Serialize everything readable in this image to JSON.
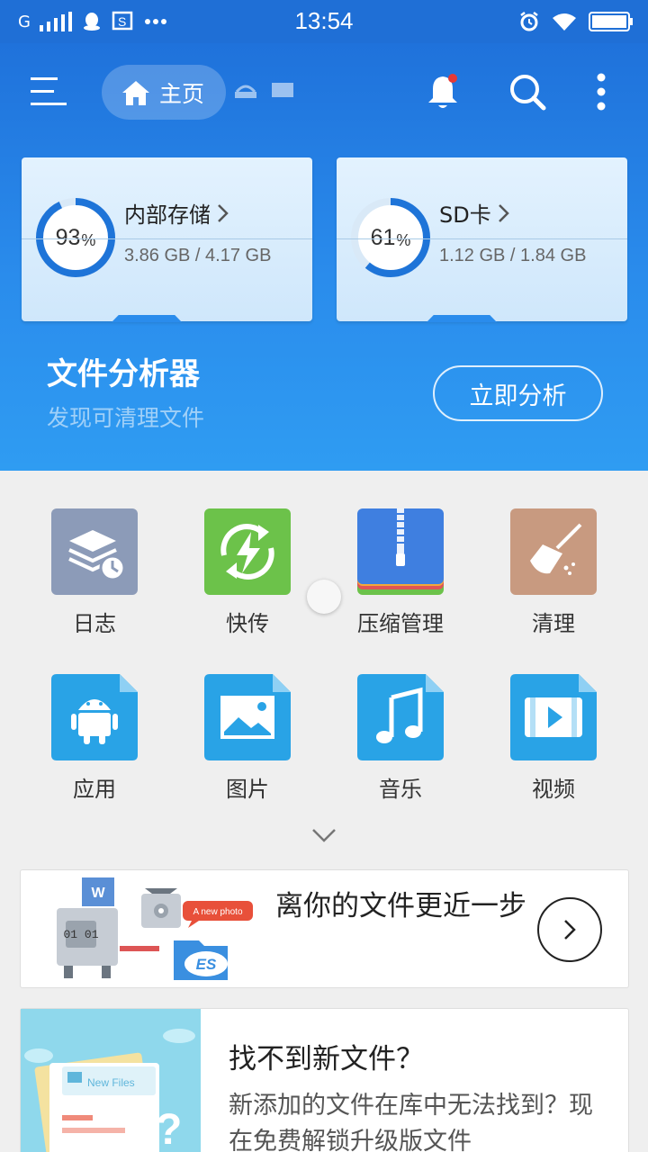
{
  "status_bar": {
    "carrier": "G",
    "time": "13:54",
    "icons": [
      "signal-icon",
      "qq-icon",
      "screenshot-icon",
      "more-dots-icon",
      "alarm-icon",
      "wifi-icon",
      "battery-icon"
    ]
  },
  "toolbar": {
    "home_label": "主页",
    "icons": [
      "menu-icon",
      "home-icon",
      "network-icon",
      "storage-icon",
      "bell-icon",
      "search-icon",
      "more-vertical-icon"
    ],
    "notification_dot_color": "#e53935"
  },
  "storage": [
    {
      "name": "内部存储",
      "percent_value": "93",
      "percent_sign": "%",
      "percent": 93,
      "usage": "3.86 GB / 4.17 GB"
    },
    {
      "name": "SD卡",
      "percent_value": "61",
      "percent_sign": "%",
      "percent": 61,
      "usage": "1.12 GB / 1.84 GB"
    }
  ],
  "analyzer": {
    "title": "文件分析器",
    "subtitle": "发现可清理文件",
    "button": "立即分析"
  },
  "categories": [
    {
      "label": "日志",
      "icon": "log-icon"
    },
    {
      "label": "快传",
      "icon": "quick-transfer-icon"
    },
    {
      "label": "压缩管理",
      "icon": "archive-icon"
    },
    {
      "label": "清理",
      "icon": "broom-icon"
    },
    {
      "label": "应用",
      "icon": "android-icon"
    },
    {
      "label": "图片",
      "icon": "image-icon"
    },
    {
      "label": "音乐",
      "icon": "music-icon"
    },
    {
      "label": "视频",
      "icon": "video-icon"
    }
  ],
  "promo1": {
    "text": "离你的文件更近一步",
    "illustration_labels": {
      "doc": "W",
      "binary": "01 01",
      "bubble": "A new photo",
      "brand": "ES"
    }
  },
  "promo2": {
    "title": "找不到新文件？",
    "description": "新添加的文件在库中无法找到？现在免费解锁升级版文件",
    "illustration_label": "New Files"
  },
  "colors": {
    "primary": "#1f6fd6",
    "accent": "#2a8cec",
    "ring": "#1e74d8"
  }
}
